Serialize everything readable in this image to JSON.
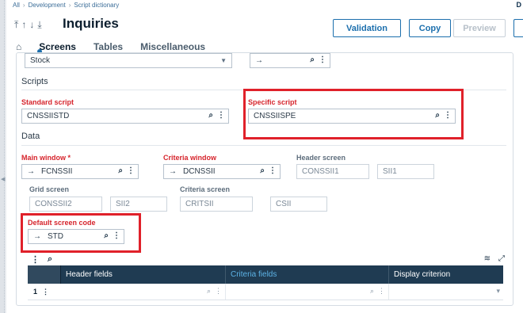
{
  "breadcrumb": [
    "All",
    "Development",
    "Script dictionary"
  ],
  "corner_badge": "D",
  "header": {
    "title": "Inquiries",
    "icons": [
      "first-record-icon",
      "previous-record-icon",
      "next-record-icon",
      "last-record-icon"
    ]
  },
  "actions": {
    "validation": "Validation",
    "copy": "Copy",
    "preview": "Preview"
  },
  "tabs": {
    "screens": "Screens",
    "tables": "Tables",
    "miscellaneous": "Miscellaneous"
  },
  "top_row": {
    "stock_value": "Stock",
    "arrow_value": "→"
  },
  "scripts": {
    "section": "Scripts",
    "standard_label": "Standard script",
    "standard_value": "CNSSIISTD",
    "specific_label": "Specific script",
    "specific_value": "CNSSIISPE"
  },
  "data": {
    "section": "Data",
    "main_window_label": "Main window",
    "main_window_value": "FCNSSII",
    "criteria_window_label": "Criteria window",
    "criteria_window_value": "DCNSSII",
    "header_screen_label": "Header screen",
    "header_screen_value": "CONSSII1",
    "header_screen_value2": "SII1",
    "grid_screen_label": "Grid screen",
    "grid_screen_value": "CONSSII2",
    "grid_screen_value2": "SII2",
    "criteria_screen_label": "Criteria screen",
    "criteria_screen_value": "CRITSII",
    "criteria_screen_value2": "CSII",
    "default_screen_label": "Default screen code",
    "default_screen_value": "STD"
  },
  "table": {
    "columns": [
      "Header fields",
      "Criteria fields",
      "Display criterion"
    ],
    "rows": [
      {
        "num": "1"
      }
    ]
  },
  "colors": {
    "accent": "#1c6fad",
    "required": "#d6242c",
    "highlight": "#e0212a",
    "table_header": "#1f3b52"
  }
}
